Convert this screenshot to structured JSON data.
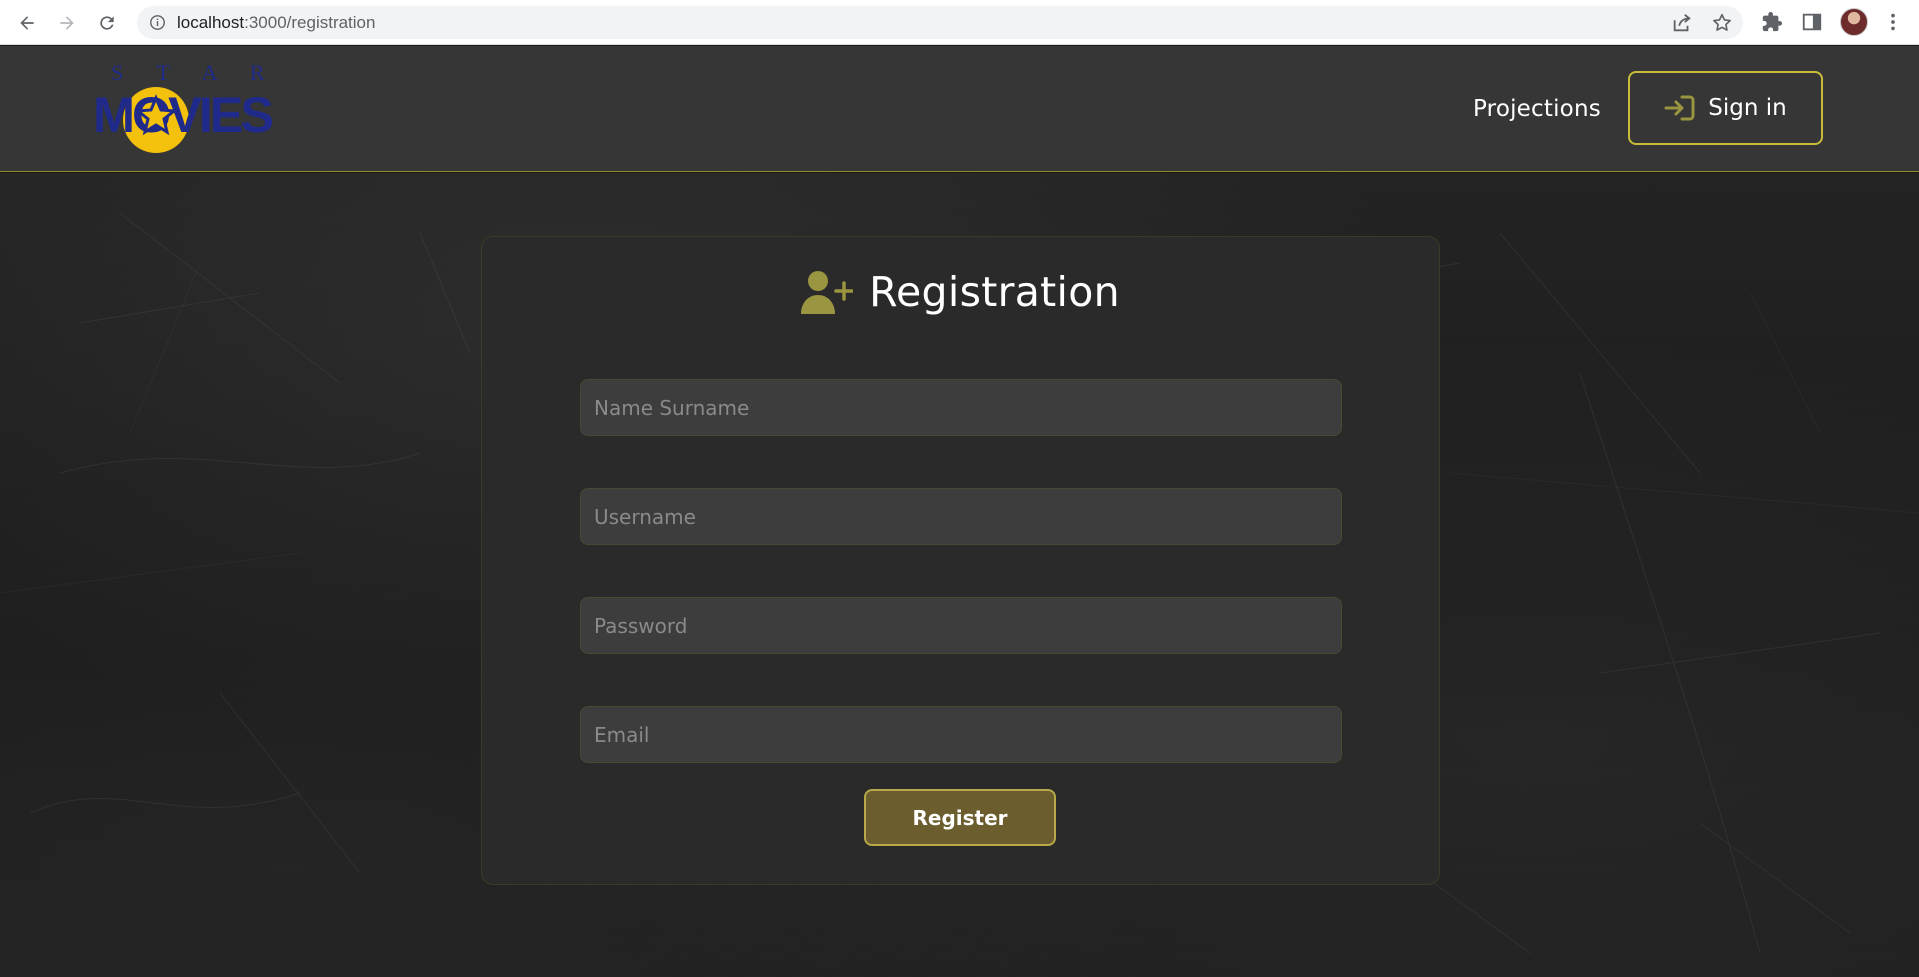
{
  "browser": {
    "url_host": "localhost",
    "url_path": ":3000/registration"
  },
  "header": {
    "logo_top_text": "S T A R",
    "logo_main_text": "MOVIES",
    "nav_projections": "Projections",
    "signin_label": "Sign in"
  },
  "form": {
    "title": "Registration",
    "fields": [
      {
        "placeholder": "Name Surname",
        "value": ""
      },
      {
        "placeholder": "Username",
        "value": ""
      },
      {
        "placeholder": "Password",
        "value": ""
      },
      {
        "placeholder": "Email",
        "value": ""
      }
    ],
    "submit_label": "Register"
  },
  "colors": {
    "accent_olive": "#9a9540",
    "accent_gold": "#c8bc3a",
    "header_bg": "#363636",
    "card_bg": "#2a2a2a",
    "button_bg": "#6b5d2e",
    "logo_blue": "#1f2a8a",
    "logo_yellow": "#f4c20d"
  },
  "icons": {
    "back": "arrow-left-icon",
    "forward": "arrow-right-icon",
    "reload": "reload-icon",
    "site_info": "info-icon",
    "share": "share-icon",
    "bookmark": "star-icon",
    "extensions": "puzzle-icon",
    "side_panel": "side-panel-icon",
    "menu": "more-vert-icon",
    "signin": "login-arrow-icon",
    "registration": "user-plus-icon"
  }
}
